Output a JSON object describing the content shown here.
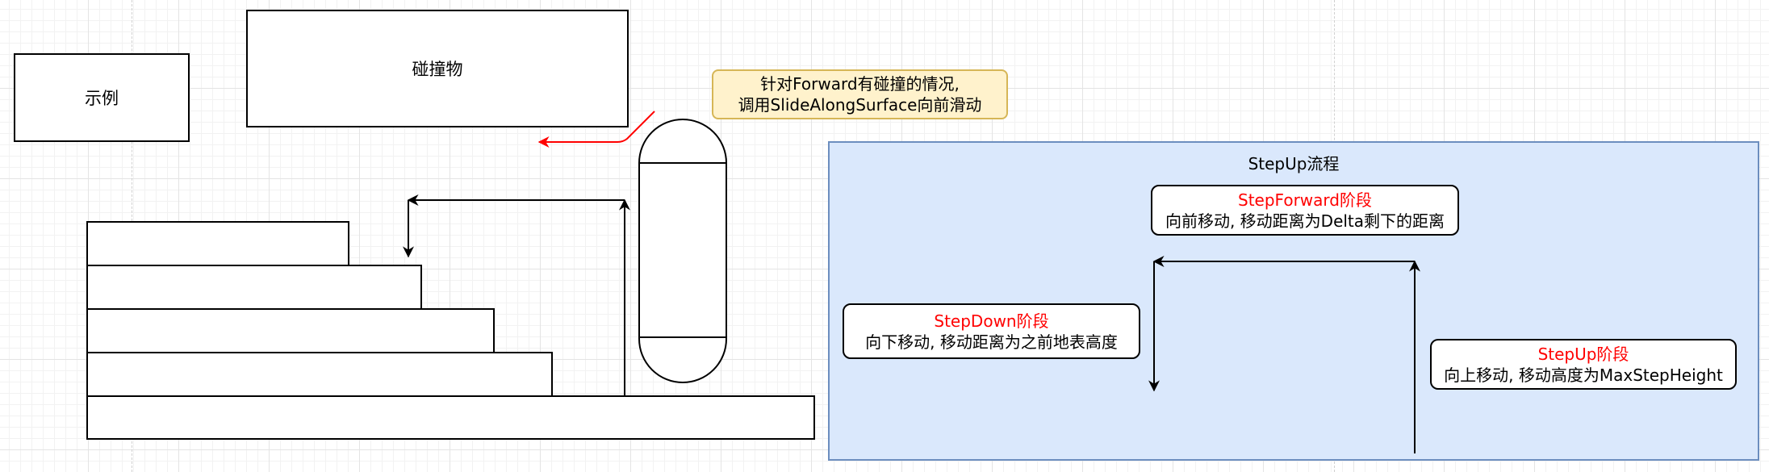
{
  "example_label": "示例",
  "obstacle_label": "碰撞物",
  "note": {
    "line1": "针对Forward有碰撞的情况,",
    "line2": "调用SlideAlongSurface向前滑动"
  },
  "stepup_panel": {
    "title": "StepUp流程",
    "forward": {
      "name": "StepForward阶段",
      "desc": "向前移动, 移动距离为Delta剩下的距离"
    },
    "down": {
      "name": "StepDown阶段",
      "desc": "向下移动, 移动距离为之前地表高度"
    },
    "up": {
      "name": "StepUp阶段",
      "desc": "向上移动, 移动高度为MaxStepHeight"
    }
  },
  "colors": {
    "stage_name": "#ff0000",
    "panel_fill": "#dae8fc",
    "panel_border": "#6c8ebf",
    "note_fill": "#fff2cc",
    "note_border": "#d6b656",
    "slide_arrow": "#ff0000"
  }
}
